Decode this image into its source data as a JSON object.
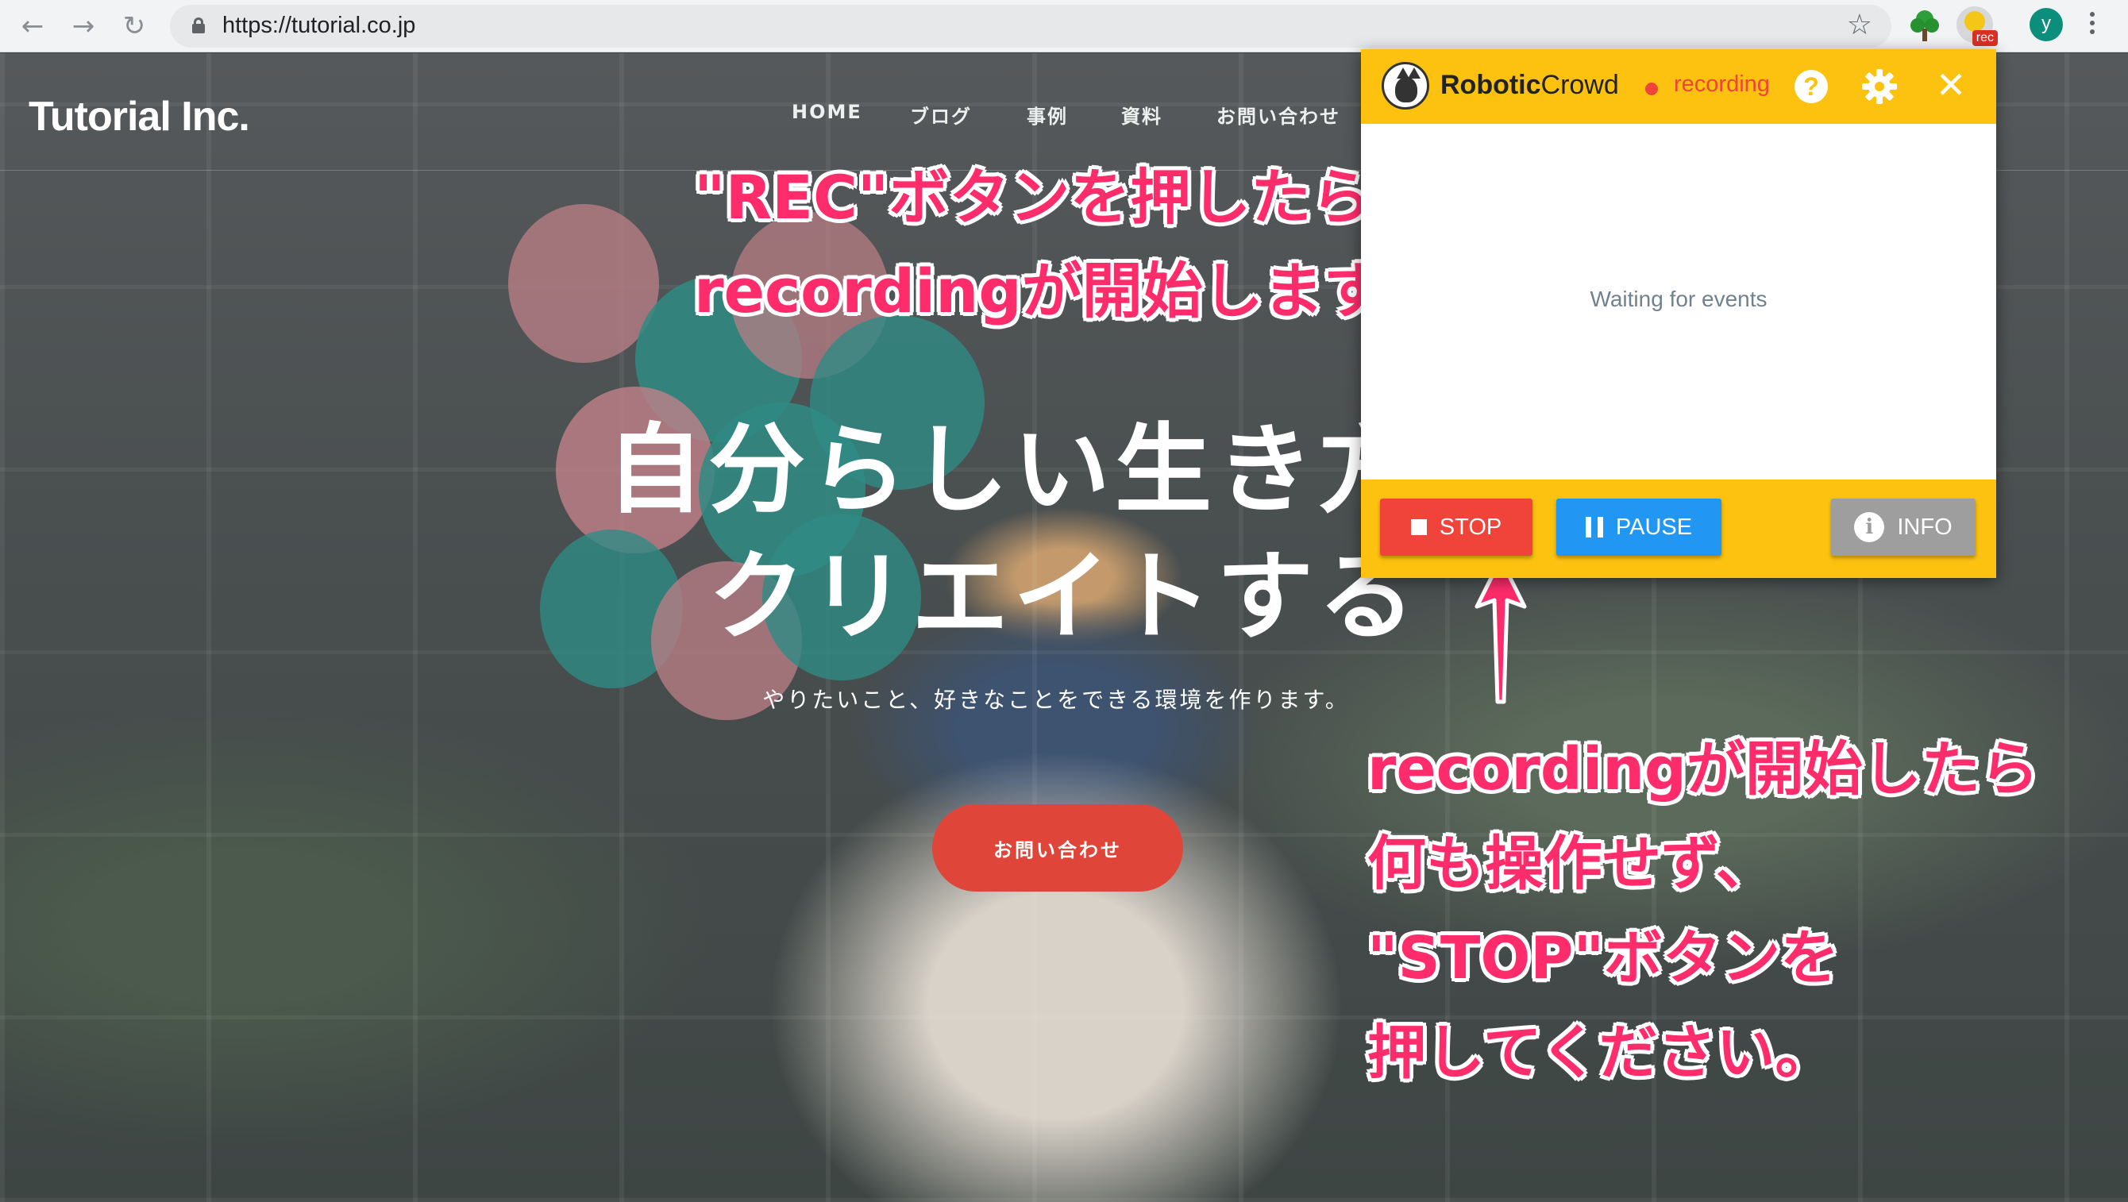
{
  "browser": {
    "url": "https://tutorial.co.jp",
    "icons": [
      "back-icon",
      "forward-icon",
      "reload-icon",
      "lock-icon",
      "bookmark-star-icon",
      "tree-extension-icon",
      "robotic-crowd-extension-icon",
      "menu-icon"
    ],
    "ext_badge": "rec",
    "profile_initial": "y"
  },
  "site": {
    "logo": "Tutorial Inc.",
    "nav": [
      "HOME",
      "ブログ",
      "事例",
      "資料",
      "お問い合わせ"
    ],
    "hero_title": [
      "自分らしい生き方を",
      "クリエイトする"
    ],
    "hero_subtitle": "やりたいこと、好きなことをできる環境を作ります。",
    "cta": "お問い合わせ",
    "cta_color": "#e0453a"
  },
  "annotations": {
    "top": [
      "\"REC\"ボタンを押したら",
      "recordingが開始します"
    ],
    "bottom": [
      "recordingが開始したら",
      "何も操作せず、",
      "\"STOP\"ボタンを",
      "押してください。"
    ],
    "color": "#ff2c6b"
  },
  "popup": {
    "brand_bold": "Robotic",
    "brand_light": "Crowd",
    "status": "recording",
    "status_color": "#f0433a",
    "header_color": "#fcc20f",
    "body_text": "Waiting for events",
    "buttons": {
      "stop": "STOP",
      "pause": "PAUSE",
      "info": "INFO"
    },
    "button_colors": {
      "stop": "#f0433a",
      "pause": "#2196f3",
      "info": "#9e9e9e"
    }
  }
}
